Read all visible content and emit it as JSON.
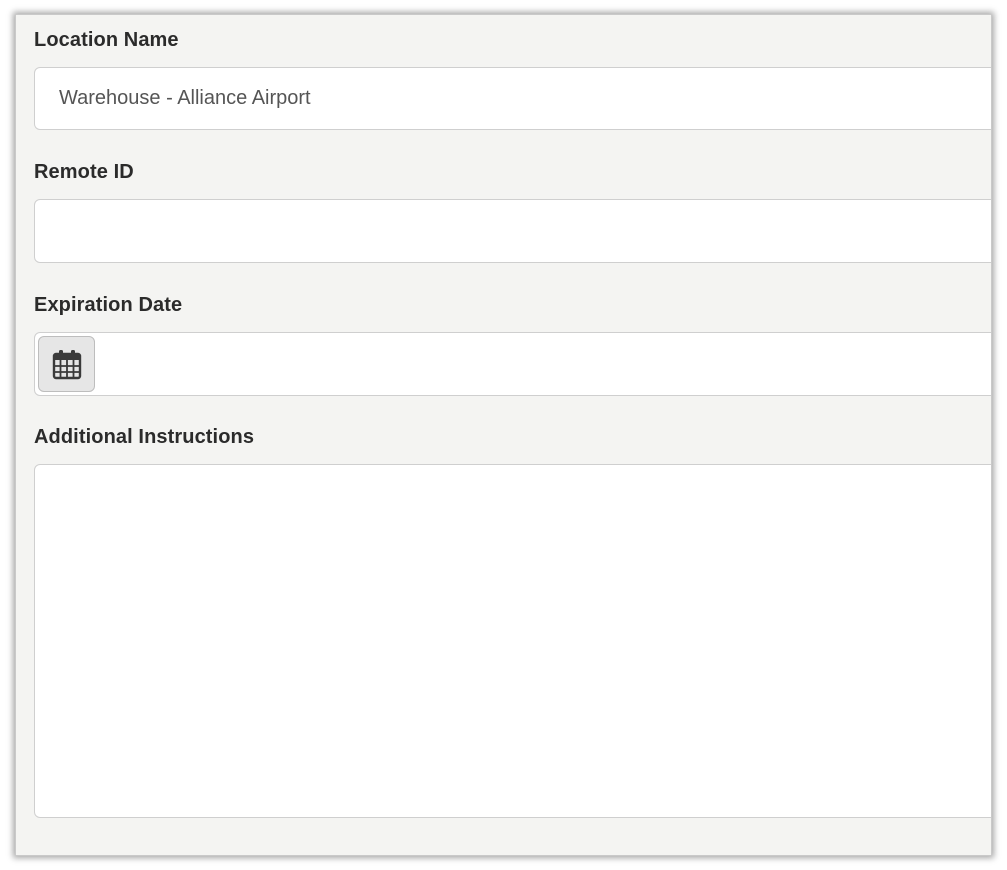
{
  "form": {
    "location_name": {
      "label": "Location Name",
      "value": "Warehouse - Alliance Airport"
    },
    "remote_id": {
      "label": "Remote ID",
      "value": ""
    },
    "expiration_date": {
      "label": "Expiration Date",
      "value": "",
      "button_icon": "calendar-icon"
    },
    "additional_instructions": {
      "label": "Additional Instructions",
      "value": ""
    }
  },
  "colors": {
    "panel_background": "#f4f4f2",
    "field_background": "#ffffff",
    "field_border": "#cfcfcf",
    "label_text": "#2b2b2b",
    "value_text": "#555555",
    "calendar_button": "#e6e6e6"
  }
}
